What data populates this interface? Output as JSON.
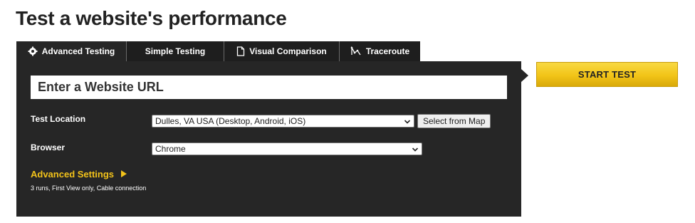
{
  "page": {
    "title": "Test a website's performance"
  },
  "tabs": [
    {
      "label": "Advanced Testing",
      "icon": "gear-icon",
      "active": true
    },
    {
      "label": "Simple Testing",
      "icon": "",
      "active": false
    },
    {
      "label": "Visual Comparison",
      "icon": "document-icon",
      "active": false
    },
    {
      "label": "Traceroute",
      "icon": "route-icon",
      "active": false
    }
  ],
  "form": {
    "url_placeholder": "Enter a Website URL",
    "test_location": {
      "label": "Test Location",
      "value": "Dulles, VA USA (Desktop, Android, iOS)",
      "map_button": "Select from Map"
    },
    "browser": {
      "label": "Browser",
      "value": "Chrome"
    },
    "advanced": {
      "label": "Advanced Settings",
      "summary": "3 runs, First View only, Cable connection"
    }
  },
  "start_button": {
    "label": "START TEST"
  },
  "colors": {
    "panel_bg": "#262626",
    "accent_yellow": "#f3c31a",
    "button_yellow": "#f2c417"
  }
}
